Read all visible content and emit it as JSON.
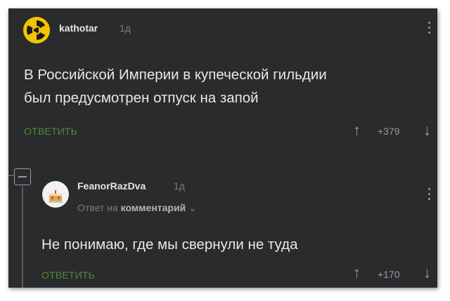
{
  "comment1": {
    "username": "kathotar",
    "time": "1д",
    "text_lines": [
      "В Российской Империи в купеческой гильдии",
      "был предусмотрен отпуск на запой"
    ],
    "reply_label": "ОТВЕТИТЬ",
    "rating": "+379",
    "avatar_icon": "radiation-icon"
  },
  "comment2": {
    "username": "FeanorRazDva",
    "time": "1д",
    "reply_context_prefix": "Ответ на",
    "reply_context_link": "комментарий",
    "text": "Не понимаю, где мы свернули не туда",
    "reply_label": "ОТВЕТИТЬ",
    "rating": "+170",
    "avatar_icon": "cake-icon"
  },
  "icons": {
    "upvote": "↑",
    "downvote": "↓",
    "chevron": "⌄"
  },
  "colors": {
    "background": "#2a2b2d",
    "reply_green": "#4f8a3b",
    "radiation_yellow": "#f5c400"
  }
}
